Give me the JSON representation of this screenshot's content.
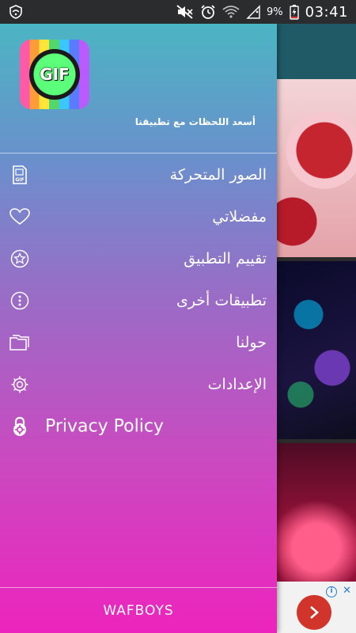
{
  "status_bar": {
    "battery_percent": "9%",
    "time": "03:41",
    "icons": [
      "shield-wifi-icon",
      "mute-icon",
      "alarm-icon",
      "wifi-icon",
      "signal-icon",
      "battery-charging-icon"
    ]
  },
  "drawer": {
    "app_logo_text": "GIF",
    "tagline": "أسعد اللحظات مع تطبيقنا",
    "menu": [
      {
        "label": "الصور المتحركة",
        "icon": "gif-file-icon"
      },
      {
        "label": "مفضلاتي",
        "icon": "heart-icon"
      },
      {
        "label": "تقييم التطبيق",
        "icon": "star-badge-icon"
      },
      {
        "label": "تطبيقات أخرى",
        "icon": "more-apps-icon"
      },
      {
        "label": "حولنا",
        "icon": "folder-icon"
      },
      {
        "label": "الإعدادات",
        "icon": "gear-icon"
      },
      {
        "label": "Privacy Policy",
        "icon": "lock-icon"
      }
    ],
    "footer": "WAFBOYS"
  },
  "colors": {
    "drawer_top": "#4bb5c3",
    "drawer_bottom": "#ec24bd",
    "status_bar": "#2a2c2e",
    "ad_button": "#d1342b"
  }
}
